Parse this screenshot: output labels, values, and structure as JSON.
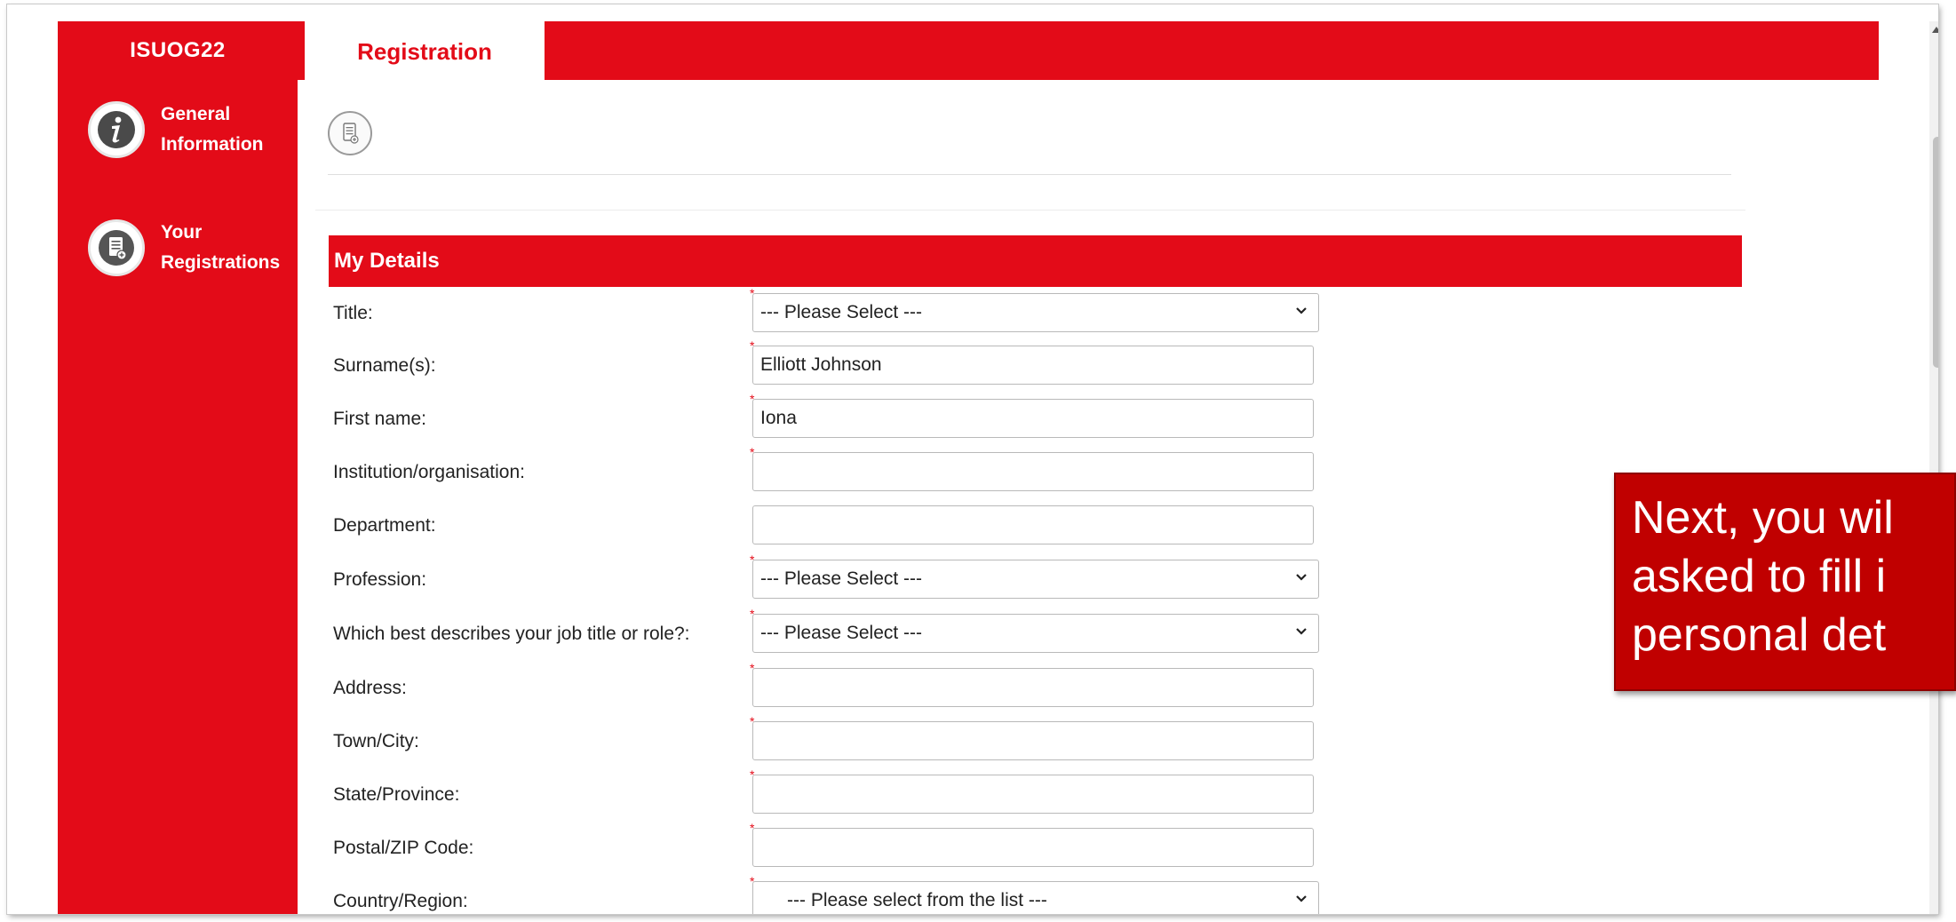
{
  "header": {
    "brand": "ISUOG22",
    "active_tab": "Registration"
  },
  "sidebar": {
    "items": [
      {
        "label": "General\nInformation",
        "icon": "info-icon"
      },
      {
        "label": "Your\nRegistrations",
        "icon": "document-add-icon"
      }
    ]
  },
  "section": {
    "title": "My Details"
  },
  "form": {
    "fields": [
      {
        "label": "Title:",
        "value": "--- Please Select ---",
        "type": "select",
        "required": true
      },
      {
        "label": "Surname(s):",
        "value": "Elliott Johnson",
        "type": "text",
        "required": true
      },
      {
        "label": "First name:",
        "value": "Iona",
        "type": "text",
        "required": true
      },
      {
        "label": "Institution/organisation:",
        "value": "",
        "type": "text",
        "required": true
      },
      {
        "label": "Department:",
        "value": "",
        "type": "text",
        "required": false
      },
      {
        "label": "Profession:",
        "value": "--- Please Select ---",
        "type": "select",
        "required": true
      },
      {
        "label": "Which best describes your job title or role?:",
        "value": "--- Please Select ---",
        "type": "select",
        "required": true
      },
      {
        "label": "Address:",
        "value": "",
        "type": "text",
        "required": true
      },
      {
        "label": "Town/City:",
        "value": "",
        "type": "text",
        "required": true
      },
      {
        "label": "State/Province:",
        "value": "",
        "type": "text",
        "required": true
      },
      {
        "label": "Postal/ZIP Code:",
        "value": "",
        "type": "text",
        "required": true
      },
      {
        "label": "Country/Region:",
        "value": "--- Please select from the list ---",
        "type": "select",
        "required": true
      }
    ]
  },
  "callout": {
    "text": "Next, you wil\nasked to fill i\npersonal det"
  },
  "colors": {
    "brand_red": "#e30b18",
    "callout_red": "#c00000"
  }
}
